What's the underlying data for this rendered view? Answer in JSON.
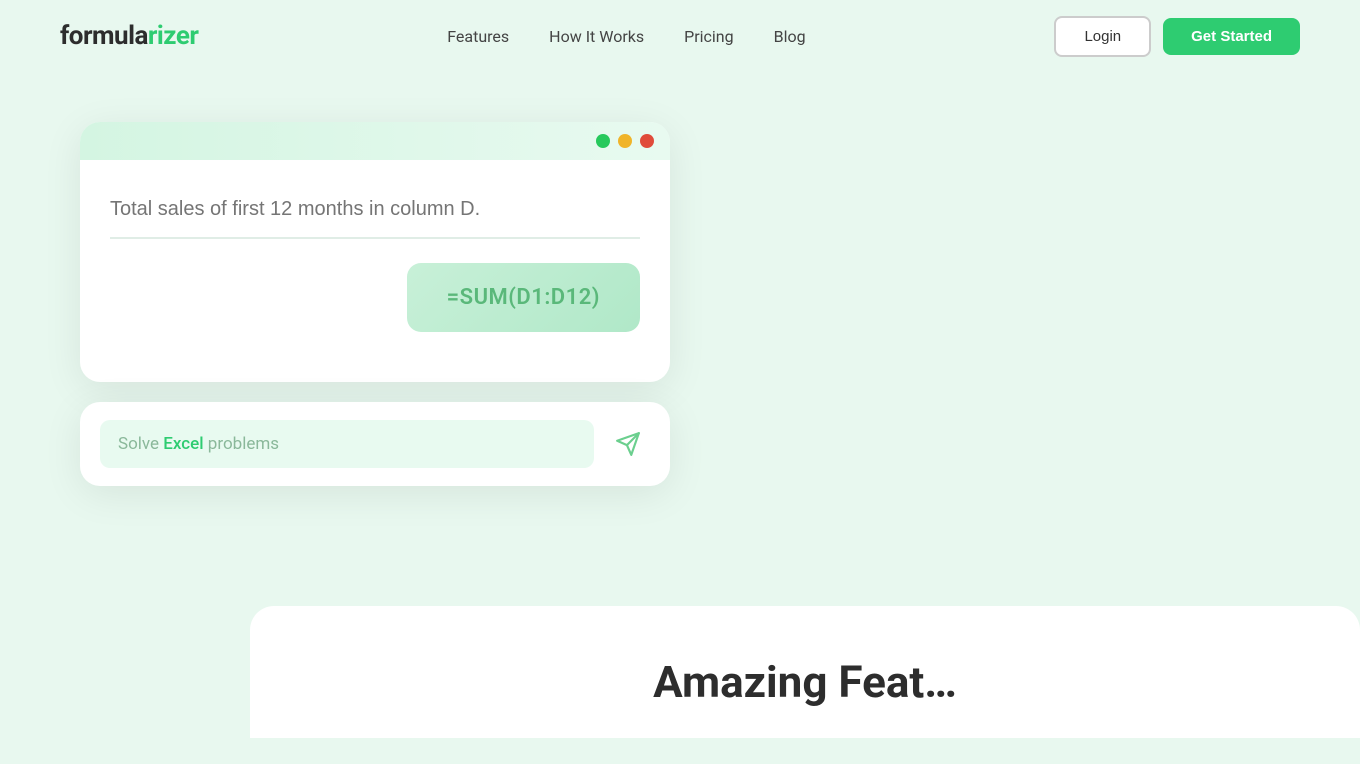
{
  "brand": {
    "name_part1": "formula",
    "name_part2": "rizer"
  },
  "nav": {
    "links": [
      {
        "label": "Features",
        "id": "features"
      },
      {
        "label": "How It Works",
        "id": "how-it-works"
      },
      {
        "label": "Pricing",
        "id": "pricing"
      },
      {
        "label": "Blog",
        "id": "blog"
      }
    ],
    "login_label": "Login",
    "get_started_label": "Get Started"
  },
  "demo_card": {
    "prompt_placeholder": "Total sales of first 12 months in column D.",
    "formula_result": "=SUM(D1:D12)"
  },
  "search_bar": {
    "prefix": "Solve ",
    "highlight": "Excel",
    "suffix": " problems",
    "placeholder": "Solve Excel problems"
  },
  "features_section": {
    "title_part1": "Amazing Feat",
    "title_suffix": "..."
  },
  "colors": {
    "green": "#2ecc71",
    "bg": "#e8f8ef",
    "dot_green": "#27c95c",
    "dot_yellow": "#f0b429",
    "dot_red": "#e04b3a"
  }
}
